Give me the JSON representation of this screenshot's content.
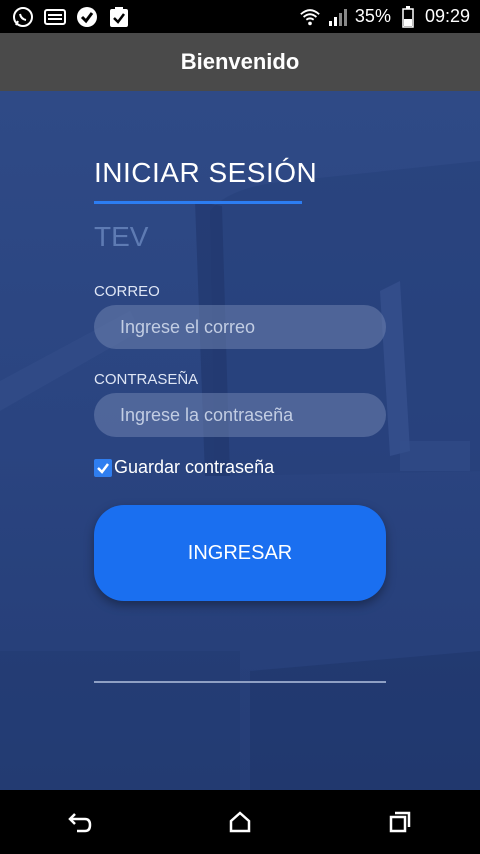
{
  "status_bar": {
    "battery": "35%",
    "time": "09:29",
    "icons": [
      "whatsapp-icon",
      "keyboard-icon",
      "check-shield-icon",
      "clipboard-check-icon",
      "wifi-icon",
      "signal-icon",
      "battery-icon"
    ]
  },
  "app_bar": {
    "title": "Bienvenido"
  },
  "login": {
    "title": "INICIAR SESIÓN",
    "app_name": "TEV",
    "email_label": "CORREO",
    "email_placeholder": "Ingrese el correo",
    "password_label": "CONTRASEÑA",
    "password_placeholder": "Ingrese la contraseña",
    "remember_label": "Guardar contraseña",
    "remember_checked": true,
    "submit_label": "INGRESAR"
  },
  "nav_bar": {
    "icons": [
      "back-icon",
      "home-icon",
      "recents-icon"
    ]
  },
  "colors": {
    "accent": "#1a6ff0",
    "background": "#2c4682",
    "app_bar": "#4a4a4a"
  }
}
